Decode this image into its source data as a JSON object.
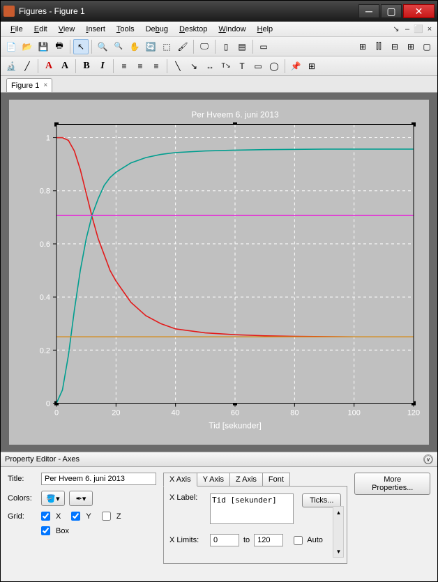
{
  "window": {
    "title": "Figures - Figure 1"
  },
  "menu": {
    "file": "File",
    "edit": "Edit",
    "view": "View",
    "insert": "Insert",
    "tools": "Tools",
    "debug": "Debug",
    "desktop": "Desktop",
    "window": "Window",
    "help": "Help"
  },
  "tab": {
    "label": "Figure 1"
  },
  "chart_data": {
    "type": "line",
    "title": "Per Hveem 6. juni 2013",
    "xlabel": "Tid [sekunder]",
    "ylabel": "",
    "xlim": [
      0,
      120
    ],
    "ylim": [
      0,
      1.05
    ],
    "xticks": [
      0,
      20,
      40,
      60,
      80,
      100,
      120
    ],
    "yticks": [
      0,
      0.2,
      0.4,
      0.6,
      0.8,
      1
    ],
    "x": [
      0,
      2,
      4,
      6,
      8,
      10,
      12,
      14,
      16,
      18,
      20,
      25,
      30,
      35,
      40,
      50,
      60,
      70,
      80,
      90,
      100,
      110,
      120
    ],
    "series": [
      {
        "name": "red",
        "color": "#e21b1b",
        "values": [
          1.0,
          1.0,
          0.99,
          0.95,
          0.88,
          0.79,
          0.7,
          0.62,
          0.56,
          0.5,
          0.46,
          0.38,
          0.33,
          0.3,
          0.28,
          0.265,
          0.258,
          0.254,
          0.252,
          0.251,
          0.25,
          0.25,
          0.25
        ]
      },
      {
        "name": "teal",
        "color": "#009e8f",
        "values": [
          0.0,
          0.05,
          0.18,
          0.35,
          0.5,
          0.62,
          0.71,
          0.77,
          0.82,
          0.85,
          0.87,
          0.905,
          0.925,
          0.937,
          0.944,
          0.95,
          0.953,
          0.955,
          0.956,
          0.957,
          0.957,
          0.957,
          0.957
        ]
      },
      {
        "name": "magenta",
        "color": "#e235d6",
        "values": [
          0.707,
          0.707,
          0.707,
          0.707,
          0.707,
          0.707,
          0.707,
          0.707,
          0.707,
          0.707,
          0.707,
          0.707,
          0.707,
          0.707,
          0.707,
          0.707,
          0.707,
          0.707,
          0.707,
          0.707,
          0.707,
          0.707,
          0.707
        ]
      },
      {
        "name": "orange",
        "color": "#d38c1f",
        "values": [
          0.25,
          0.25,
          0.25,
          0.25,
          0.25,
          0.25,
          0.25,
          0.25,
          0.25,
          0.25,
          0.25,
          0.25,
          0.25,
          0.25,
          0.25,
          0.25,
          0.25,
          0.25,
          0.25,
          0.25,
          0.25,
          0.25,
          0.25
        ]
      }
    ]
  },
  "prop": {
    "header": "Property Editor - Axes",
    "titleLabel": "Title:",
    "titleValue": "Per Hveem 6. juni 2013",
    "colorsLabel": "Colors:",
    "gridLabel": "Grid:",
    "gridX": "X",
    "gridY": "Y",
    "gridZ": "Z",
    "boxLabel": "Box",
    "tabs": {
      "x": "X Axis",
      "y": "Y Axis",
      "z": "Z Axis",
      "font": "Font"
    },
    "xlabelLabel": "X Label:",
    "xlabelValue": "Tid [sekunder]",
    "ticksBtn": "Ticks...",
    "xlimitsLabel": "X Limits:",
    "xlimitsFrom": "0",
    "toLabel": "to",
    "xlimitsTo": "120",
    "autoLabel": "Auto",
    "morePropsBtn": "More Properties..."
  }
}
